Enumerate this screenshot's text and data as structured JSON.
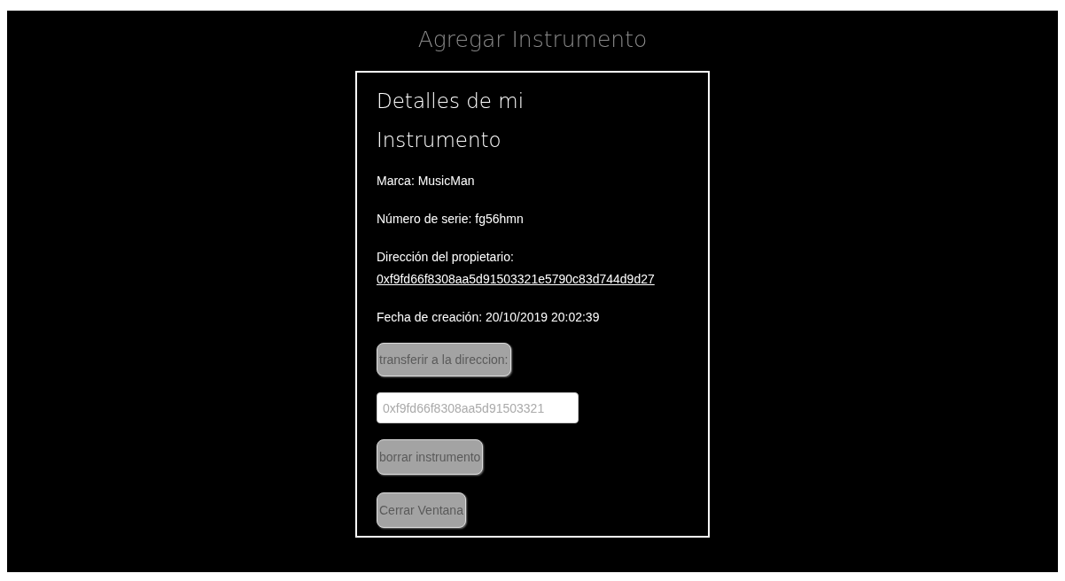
{
  "page_title": "Agregar Instrumento",
  "card": {
    "heading": "Detalles de mi Instrumento",
    "fields": [
      {
        "kind": "text",
        "label": "Marca: MusicMan"
      },
      {
        "kind": "text",
        "label": "Número de serie: fg56hmn"
      },
      {
        "kind": "link",
        "label": "Dirección del propietario:",
        "value": "0xf9fd66f8308aa5d91503321e5790c83d744d9d27"
      },
      {
        "kind": "text",
        "label": "Fecha de creación: 20/10/2019 20:02:39"
      }
    ],
    "transfer_button": "transferir a la direccion:",
    "address_input": {
      "placeholder": "0xf9fd66f8308aa5d91503321"
    },
    "delete_button": "borrar instrumento",
    "close_button": "Cerrar Ventana"
  }
}
